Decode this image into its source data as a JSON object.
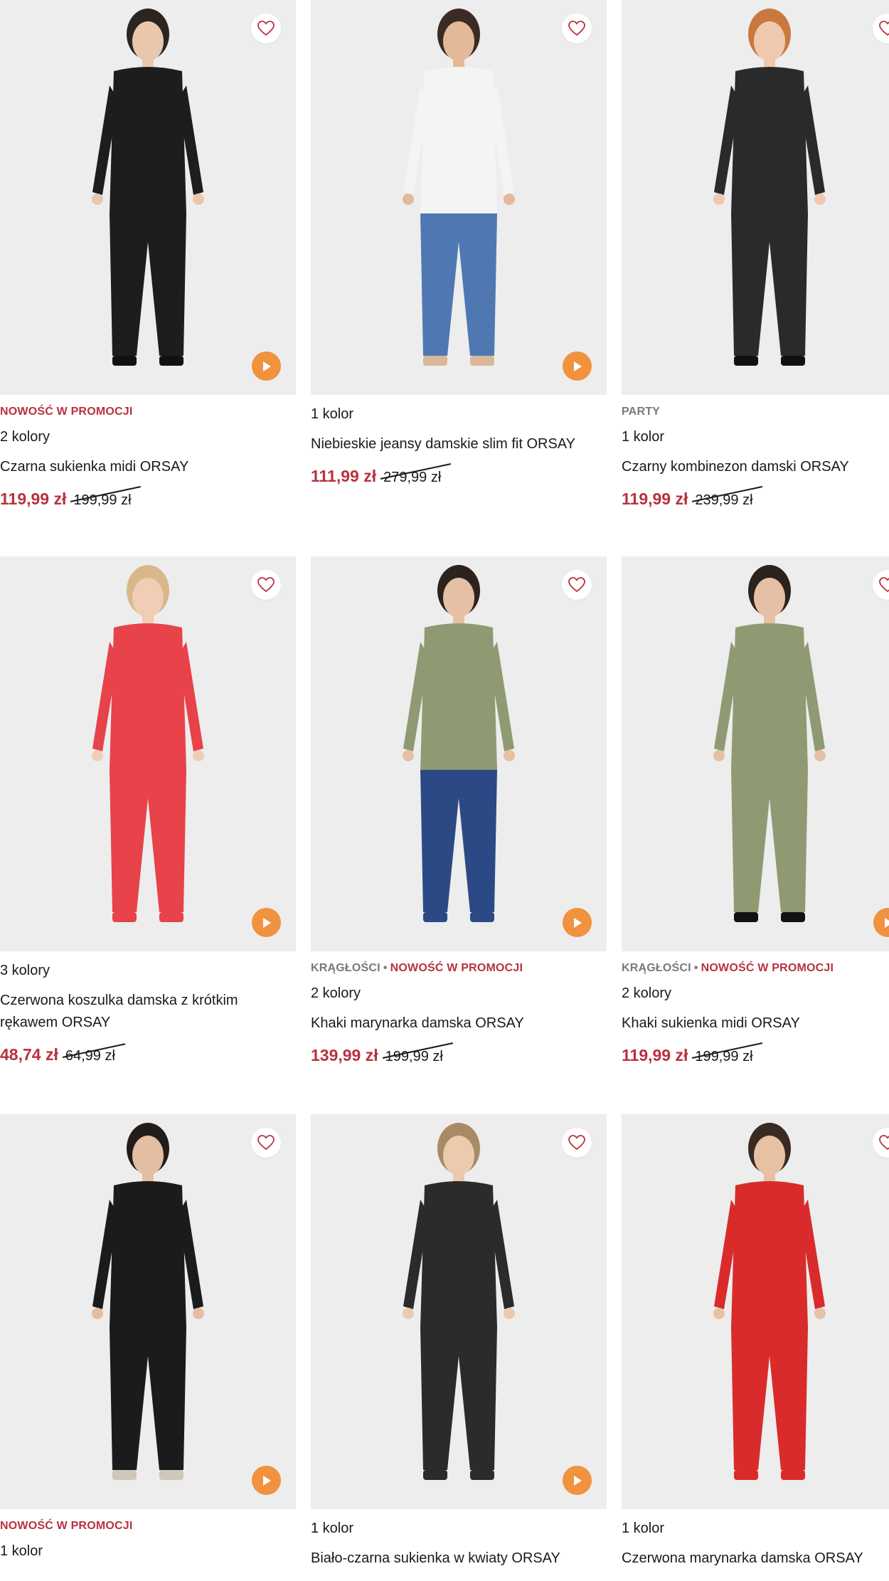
{
  "colors": {
    "price_red": "#b8323f",
    "tag_grey": "#7a7a7a",
    "play_orange": "#f0923e",
    "heart_red": "#b8323f",
    "image_bg": "#ededed"
  },
  "products": [
    {
      "tags": [
        {
          "text": "NOWOŚĆ W PROMOCJI",
          "style": "red"
        }
      ],
      "colors": "2 kolory",
      "title": "Czarna sukienka midi ORSAY",
      "price": "119,99 zł",
      "old_price": "199,99 zł",
      "has_play": true,
      "figure": {
        "skin": "#e9c7ad",
        "hair": "#2b2521",
        "top": "#1d1d1d",
        "bottom": "#1d1d1d",
        "shoes": "#111111"
      }
    },
    {
      "tags": [],
      "colors": "1 kolor",
      "title": "Niebieskie jeansy damskie slim fit ORSAY",
      "price": "111,99 zł",
      "old_price": "279,99 zł",
      "has_play": true,
      "figure": {
        "skin": "#e3b99a",
        "hair": "#3a2c24",
        "top": "#f4f4f2",
        "bottom": "#4f78b2",
        "shoes": "#d8b79a"
      }
    },
    {
      "tags": [
        {
          "text": "PARTY",
          "style": "grey"
        }
      ],
      "colors": "1 kolor",
      "title": "Czarny kombinezon damski ORSAY",
      "price": "119,99 zł",
      "old_price": "239,99 zł",
      "has_play": false,
      "figure": {
        "skin": "#efc9ad",
        "hair": "#c9793f",
        "top": "#2a2a2a",
        "bottom": "#2a2a2a",
        "shoes": "#111111"
      }
    },
    {
      "tags": [],
      "colors": "3 kolory",
      "title": "Czerwona koszulka damska z krótkim rękawem ORSAY",
      "price": "48,74 zł",
      "old_price": "64,99 zł",
      "has_play": true,
      "figure": {
        "skin": "#f0cdb5",
        "hair": "#d8b88a",
        "top": "#e8424a",
        "bottom": "#e8424a",
        "shoes": "#e8424a"
      }
    },
    {
      "tags": [
        {
          "text": "KRĄGŁOŚCI",
          "style": "grey"
        },
        {
          "text": "NOWOŚĆ W PROMOCJI",
          "style": "red"
        }
      ],
      "colors": "2 kolory",
      "title": "Khaki marynarka damska ORSAY",
      "price": "139,99 zł",
      "old_price": "199,99 zł",
      "has_play": true,
      "figure": {
        "skin": "#e6c0a4",
        "hair": "#2c231e",
        "top": "#8f9a72",
        "bottom": "#2b4a85",
        "shoes": "#2b4a85"
      }
    },
    {
      "tags": [
        {
          "text": "KRĄGŁOŚCI",
          "style": "grey"
        },
        {
          "text": "NOWOŚĆ W PROMOCJI",
          "style": "red"
        }
      ],
      "colors": "2 kolory",
      "title": "Khaki sukienka midi ORSAY",
      "price": "119,99 zł",
      "old_price": "199,99 zł",
      "has_play": true,
      "figure": {
        "skin": "#e6c0a4",
        "hair": "#2c231e",
        "top": "#8f9a72",
        "bottom": "#8f9a72",
        "shoes": "#111111"
      }
    },
    {
      "tags": [
        {
          "text": "NOWOŚĆ W PROMOCJI",
          "style": "red"
        }
      ],
      "colors": "1 kolor",
      "title": "",
      "price": "",
      "old_price": "",
      "has_play": true,
      "figure": {
        "skin": "#e3bea3",
        "hair": "#231d1a",
        "top": "#1b1b1b",
        "bottom": "#1b1b1b",
        "shoes": "#cfc6bc"
      }
    },
    {
      "tags": [],
      "colors": "1 kolor",
      "title": "Biało-czarna sukienka w kwiaty ORSAY",
      "price": "",
      "old_price": "",
      "has_play": true,
      "figure": {
        "skin": "#eccaae",
        "hair": "#a98a66",
        "top": "#2b2b2b",
        "bottom": "#2b2b2b",
        "shoes": "#2b2b2b"
      }
    },
    {
      "tags": [],
      "colors": "1 kolor",
      "title": "Czerwona marynarka damska ORSAY",
      "price": "",
      "old_price": "",
      "has_play": false,
      "figure": {
        "skin": "#e7c1a4",
        "hair": "#3a2b22",
        "top": "#d92b2b",
        "bottom": "#d92b2b",
        "shoes": "#d92b2b"
      }
    }
  ],
  "icons": {
    "favorite": "heart-outline-icon",
    "play": "play-icon"
  }
}
